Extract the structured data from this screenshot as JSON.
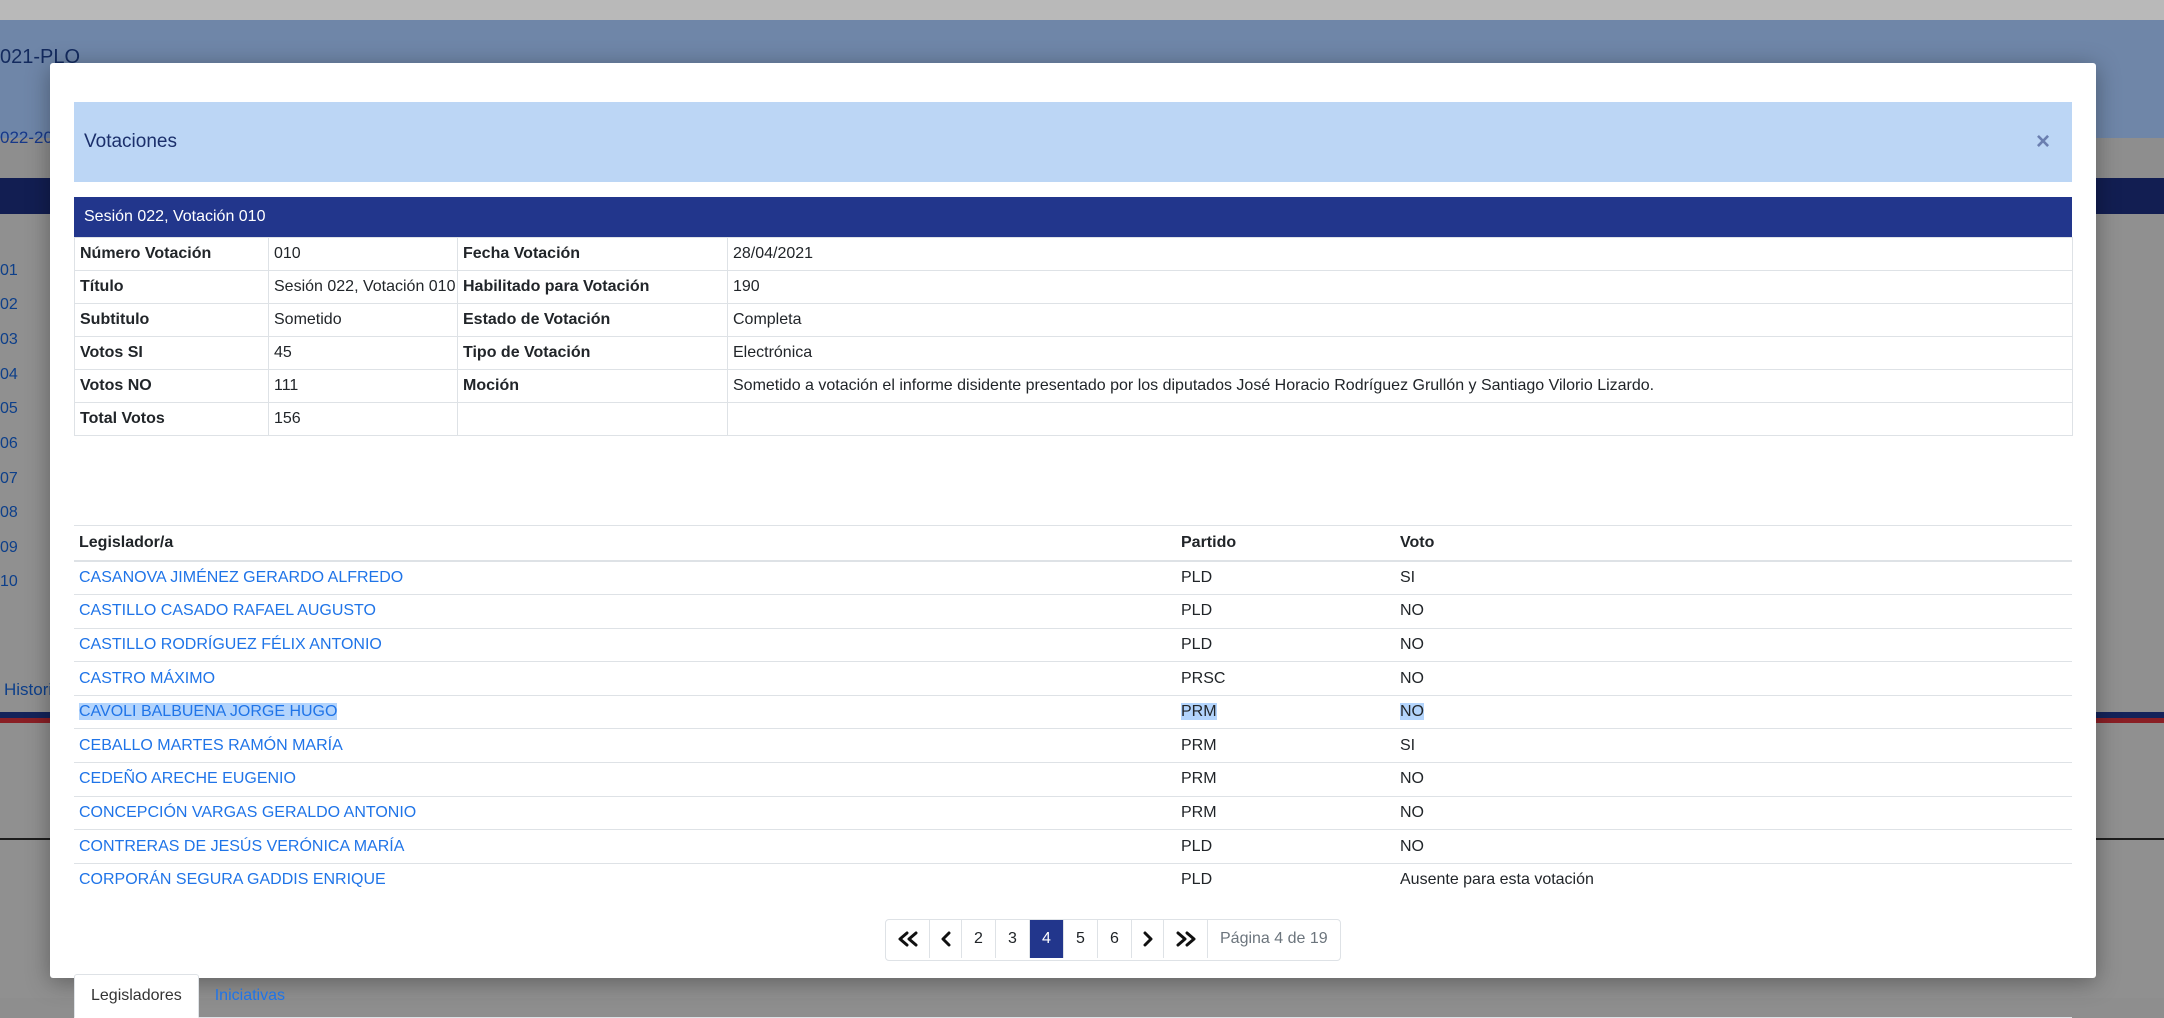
{
  "background": {
    "title": "021-PLO",
    "subline": "022-20",
    "row_numbers": [
      "01",
      "02",
      "03",
      "04",
      "05",
      "06",
      "07",
      "08",
      "09",
      "10"
    ],
    "history_link": "Historia"
  },
  "modal": {
    "title": "Votaciones",
    "close_label": "×",
    "section_title": "Sesión 022, Votación 010",
    "info": {
      "numero_label": "Número Votación",
      "numero_value": "010",
      "fecha_label": "Fecha Votación",
      "fecha_value": "28/04/2021",
      "titulo_label": "Título",
      "titulo_value": "Sesión 022, Votación 010",
      "habilitado_label": "Habilitado para Votación",
      "habilitado_value": "190",
      "subtitulo_label": "Subtitulo",
      "subtitulo_value": "Sometido",
      "estado_label": "Estado de Votación",
      "estado_value": "Completa",
      "si_label": "Votos SI",
      "si_value": "45",
      "tipo_label": "Tipo de Votación",
      "tipo_value": "Electrónica",
      "no_label": "Votos NO",
      "no_value": "111",
      "mocion_label": "Moción",
      "mocion_value": "Sometido a votación el informe disidente presentado por los diputados José Horacio Rodríguez Grullón y Santiago Vilorio Lizardo.",
      "total_label": "Total Votos",
      "total_value": "156"
    },
    "legislators": {
      "columns": {
        "name": "Legislador/a",
        "party": "Partido",
        "vote": "Voto"
      },
      "rows": [
        {
          "name": "CASANOVA JIMÉNEZ GERARDO ALFREDO",
          "party": "PLD",
          "vote": "SI"
        },
        {
          "name": "CASTILLO CASADO RAFAEL AUGUSTO",
          "party": "PLD",
          "vote": "NO"
        },
        {
          "name": "CASTILLO RODRÍGUEZ FÉLIX ANTONIO",
          "party": "PLD",
          "vote": "NO"
        },
        {
          "name": "CASTRO MÁXIMO",
          "party": "PRSC",
          "vote": "NO"
        },
        {
          "name": "CAVOLI BALBUENA JORGE HUGO",
          "party": "PRM",
          "vote": "NO"
        },
        {
          "name": "CEBALLO MARTES RAMÓN MARÍA",
          "party": "PRM",
          "vote": "SI"
        },
        {
          "name": "CEDEÑO ARECHE EUGENIO",
          "party": "PRM",
          "vote": "NO"
        },
        {
          "name": "CONCEPCIÓN VARGAS GERALDO ANTONIO",
          "party": "PRM",
          "vote": "NO"
        },
        {
          "name": "CONTRERAS DE JESÚS VERÓNICA MARÍA",
          "party": "PLD",
          "vote": "NO"
        },
        {
          "name": "CORPORÁN SEGURA GADDIS ENRIQUE",
          "party": "PLD",
          "vote": "Ausente para esta votación"
        }
      ]
    },
    "pagination": {
      "first_icon": "double-chevron-left-icon",
      "prev_icon": "chevron-left-icon",
      "pages": [
        "2",
        "3",
        "4",
        "5",
        "6"
      ],
      "current_page": "4",
      "next_icon": "chevron-right-icon",
      "last_icon": "double-chevron-right-icon",
      "info": "Página 4 de 19"
    },
    "tabs": [
      {
        "label": "Legisladores",
        "active": true
      },
      {
        "label": "Iniciativas",
        "active": false
      }
    ]
  },
  "colors": {
    "header_bg": "#bcd6f5",
    "section_bar": "#22368c",
    "link": "#1f74e8",
    "selection": "#b3d4fc"
  }
}
